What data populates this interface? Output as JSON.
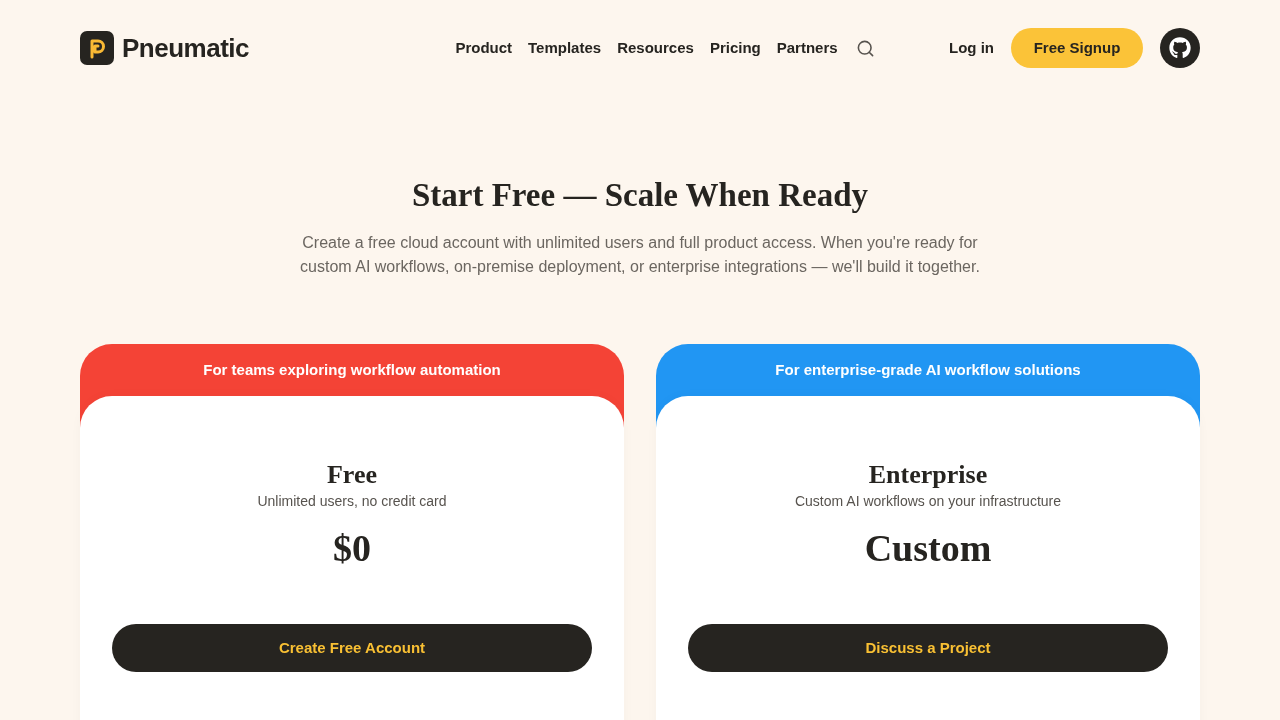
{
  "nav": {
    "brand": "Pneumatic",
    "links": [
      "Product",
      "Templates",
      "Resources",
      "Pricing",
      "Partners"
    ],
    "login": "Log in",
    "signup": "Free Signup"
  },
  "hero": {
    "title": "Start Free — Scale When Ready",
    "description": "Create a free cloud account with unlimited users and full product access. When you're ready for custom AI workflows, on-premise deployment, or enterprise integrations — we'll build it together."
  },
  "plans": [
    {
      "tagline": "For teams exploring workflow automation",
      "color": "#f44336",
      "name": "Free",
      "subtitle": "Unlimited users, no credit card",
      "price": "$0",
      "cta": "Create Free Account"
    },
    {
      "tagline": "For enterprise-grade AI workflow solutions",
      "color": "#2196f3",
      "name": "Enterprise",
      "subtitle": "Custom AI workflows on your infrastructure",
      "price": "Custom",
      "cta": "Discuss a Project"
    }
  ]
}
